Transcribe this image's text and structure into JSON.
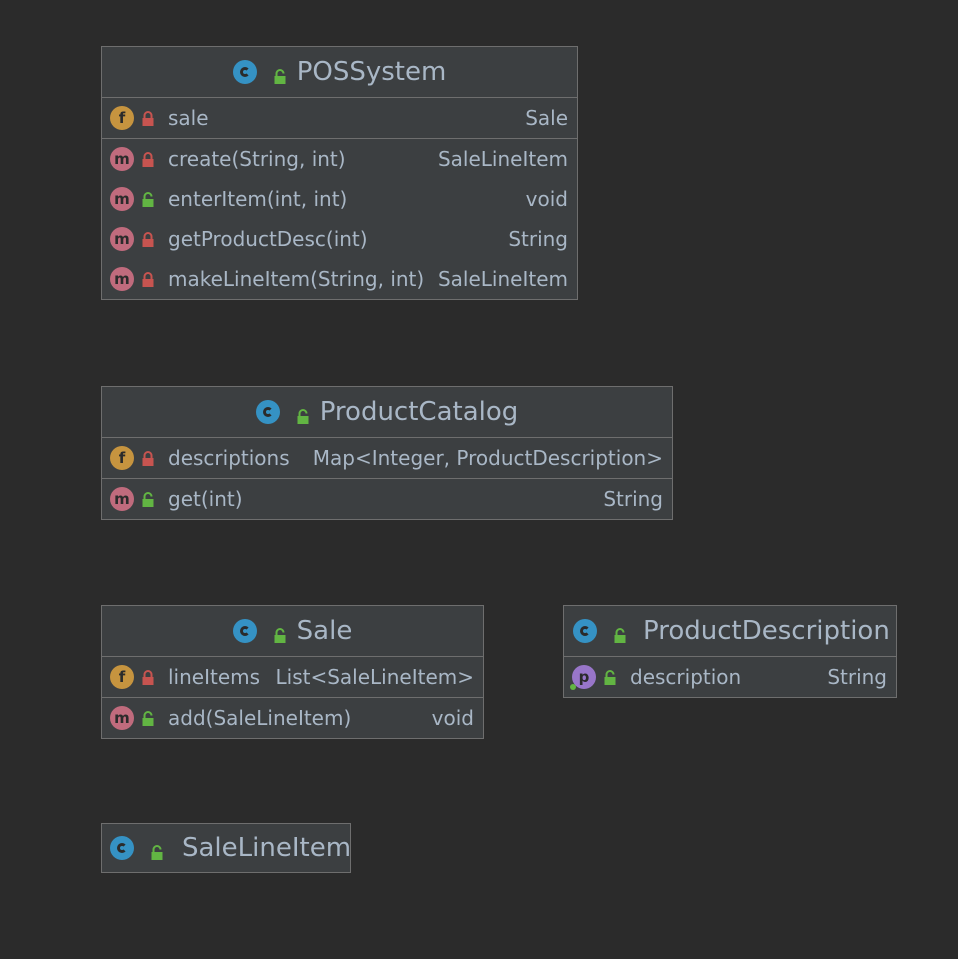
{
  "colors": {
    "background": "#2b2b2b",
    "box_fill": "#3c3f41",
    "box_border": "#6e6e6e",
    "text": "#a9b7c6",
    "class_icon": "#3592c4",
    "field_icon": "#c6943f",
    "method_icon": "#c06b7d",
    "property_icon": "#9876c9",
    "private_lock": "#c75450",
    "public_lock": "#62b543"
  },
  "classes": {
    "pos_system": {
      "name": "POSSystem",
      "fields": [
        {
          "badge": "f",
          "name": "sale",
          "type": "Sale",
          "visibility": "private"
        }
      ],
      "methods": [
        {
          "badge": "m",
          "name": "create(String, int)",
          "type": "SaleLineItem",
          "visibility": "private"
        },
        {
          "badge": "m",
          "name": "enterItem(int, int)",
          "type": "void",
          "visibility": "public"
        },
        {
          "badge": "m",
          "name": "getProductDesc(int)",
          "type": "String",
          "visibility": "private"
        },
        {
          "badge": "m",
          "name": "makeLineItem(String, int)",
          "type": "SaleLineItem",
          "visibility": "private"
        }
      ]
    },
    "product_catalog": {
      "name": "ProductCatalog",
      "fields": [
        {
          "badge": "f",
          "name": "descriptions",
          "type": "Map<Integer, ProductDescription>",
          "visibility": "private"
        }
      ],
      "methods": [
        {
          "badge": "m",
          "name": "get(int)",
          "type": "String",
          "visibility": "public"
        }
      ]
    },
    "sale": {
      "name": "Sale",
      "fields": [
        {
          "badge": "f",
          "name": "lineItems",
          "type": "List<SaleLineItem>",
          "visibility": "private"
        }
      ],
      "methods": [
        {
          "badge": "m",
          "name": "add(SaleLineItem)",
          "type": "void",
          "visibility": "public"
        }
      ]
    },
    "product_description": {
      "name": "ProductDescription",
      "properties": [
        {
          "badge": "p",
          "name": "description",
          "type": "String",
          "visibility": "public"
        }
      ]
    },
    "sale_line_item": {
      "name": "SaleLineItem"
    }
  }
}
